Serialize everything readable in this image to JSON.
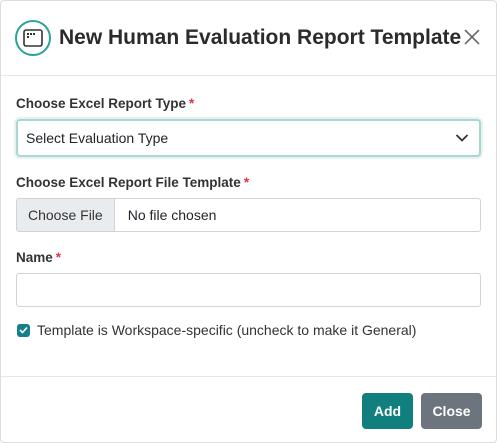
{
  "header": {
    "title": "New Human Evaluation Report Template"
  },
  "form": {
    "report_type": {
      "label": "Choose Excel Report Type",
      "required_mark": "*",
      "selected": "Select Evaluation Type"
    },
    "file_template": {
      "label": "Choose Excel Report File Template",
      "required_mark": "*",
      "button_label": "Choose File",
      "status": "No file chosen"
    },
    "name": {
      "label": "Name",
      "required_mark": "*",
      "value": ""
    },
    "workspace_checkbox": {
      "checked": true,
      "label": "Template is Workspace-specific (uncheck to make it General)"
    }
  },
  "footer": {
    "add_label": "Add",
    "close_label": "Close"
  },
  "colors": {
    "accent": "#127f7f",
    "icon_ring": "#2aa39a",
    "required": "#dc3545",
    "secondary": "#6c757d"
  }
}
